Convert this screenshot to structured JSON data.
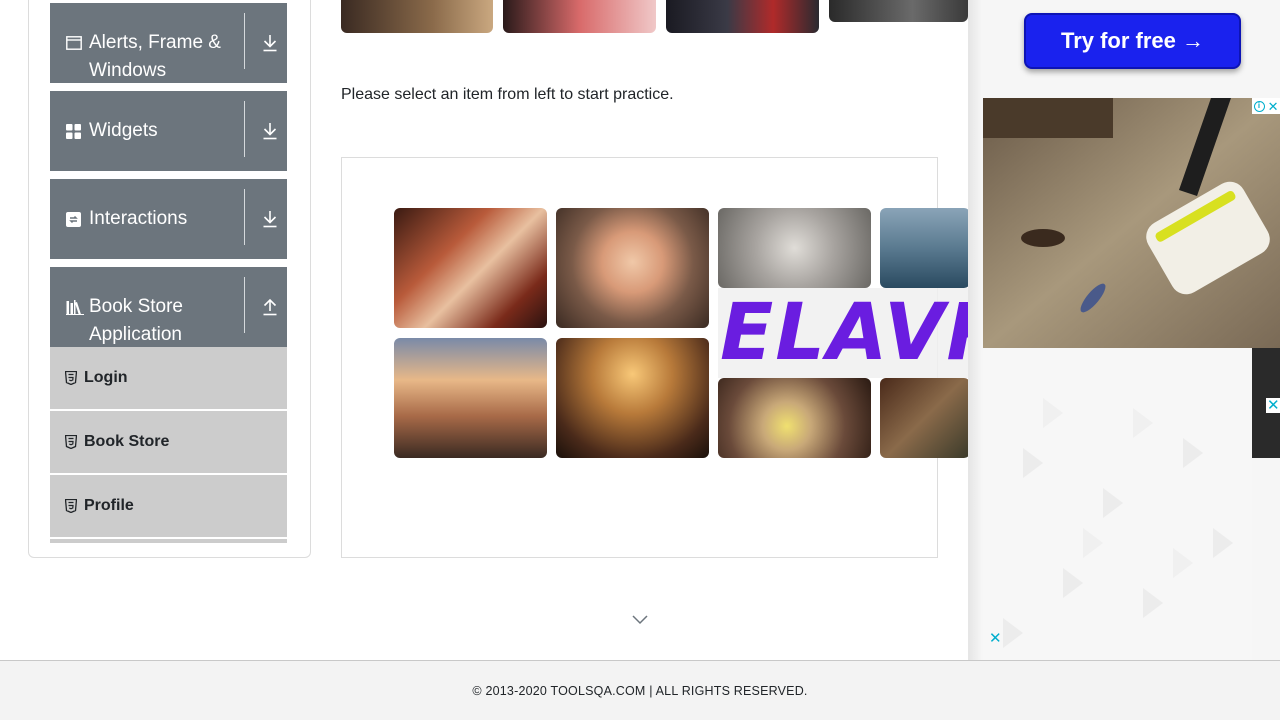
{
  "sidebar": {
    "groups": [
      {
        "label": "Alerts, Frame & Windows",
        "icon": "window-icon",
        "arrow": "download-arrow-icon"
      },
      {
        "label": "Widgets",
        "icon": "widgets-icon",
        "arrow": "download-arrow-icon"
      },
      {
        "label": "Interactions",
        "icon": "interactions-icon",
        "arrow": "download-arrow-icon"
      },
      {
        "label": "Book Store Application",
        "icon": "library-icon",
        "arrow": "upload-arrow-icon"
      }
    ],
    "book_store_items": [
      {
        "label": "Login",
        "icon": "html5-icon"
      },
      {
        "label": "Book Store",
        "icon": "html5-icon"
      },
      {
        "label": "Profile",
        "icon": "html5-icon"
      }
    ]
  },
  "main": {
    "instruction": "Please select an item from left to start practice."
  },
  "ads": {
    "try_button": "Try for free →",
    "collage_text": "ELAVR"
  },
  "footer": {
    "copyright": "© 2013-2020 TOOLSQA.COM | ALL RIGHTS RESERVED."
  },
  "colors": {
    "group_bg": "#6c757d",
    "menu_item_bg": "#cccccc",
    "try_button_bg": "#1a22ee",
    "ad_close": "#00aecd",
    "elavr_text": "#6a1de0"
  }
}
